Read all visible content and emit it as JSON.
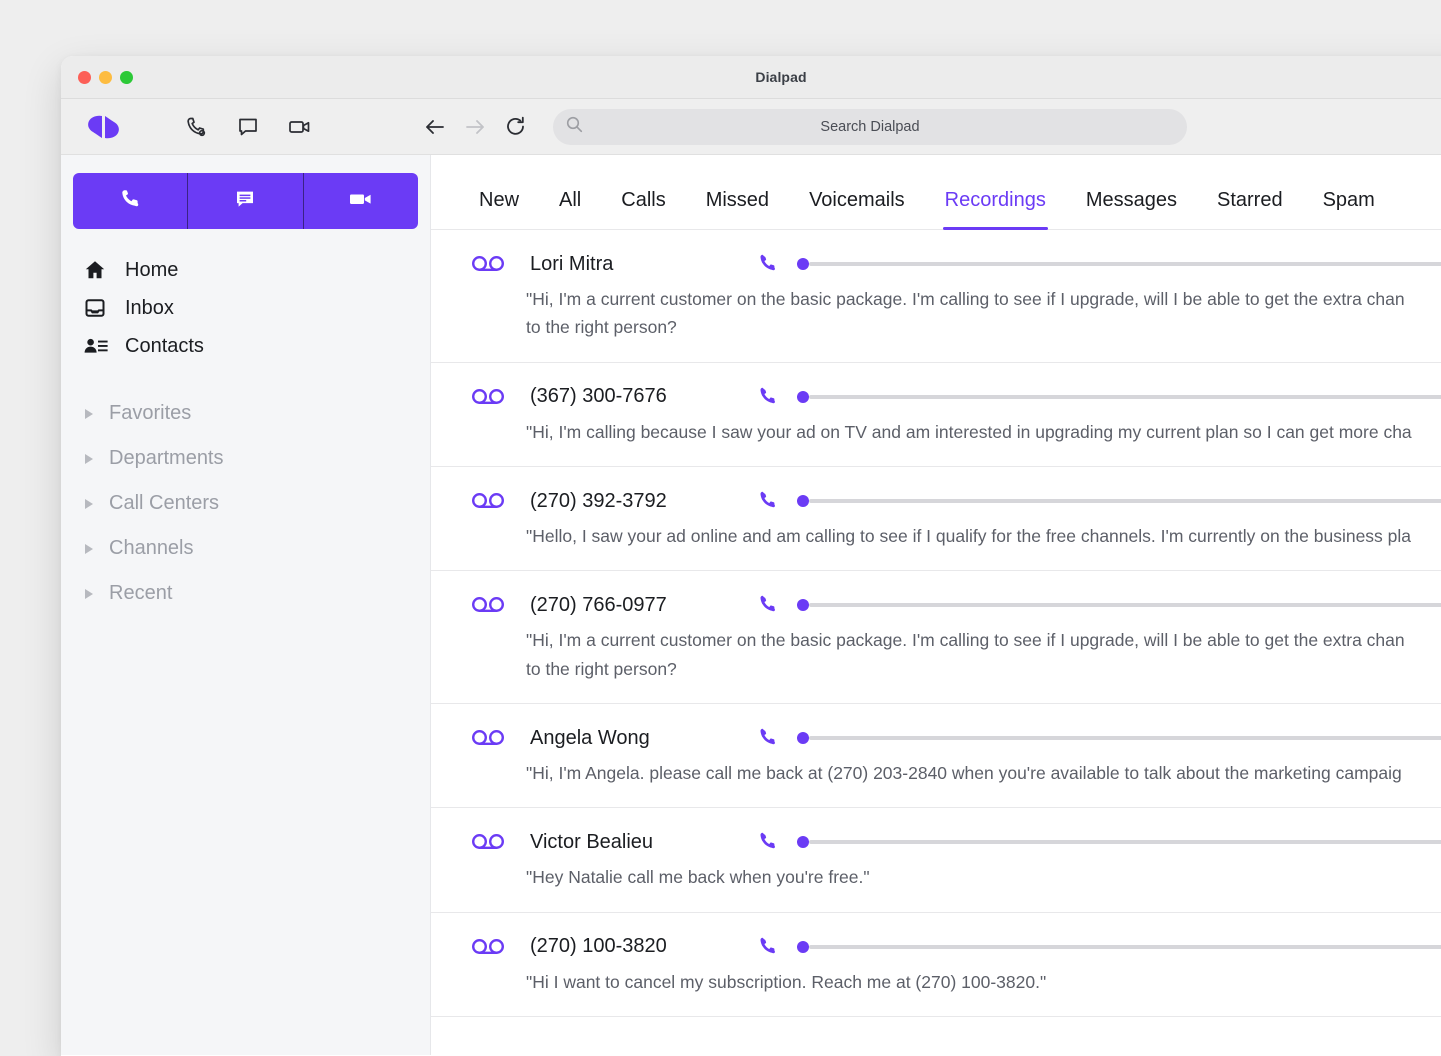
{
  "window": {
    "title": "Dialpad",
    "traffic_lights": [
      "close-red",
      "minimize-yellow",
      "maximize-green"
    ]
  },
  "colors": {
    "accent_purple": "#6b3bf5",
    "sidebar_bg": "#f5f6f8",
    "page_bg": "#eeeeee",
    "text_primary": "#1b1d21",
    "text_muted": "#9b9ea6",
    "transcript_text": "#5c5f68",
    "track_gray": "#d6d6da"
  },
  "toolbar": {
    "logo_name": "dialpad-logo",
    "icons": [
      {
        "name": "phone-icon",
        "label": "Call"
      },
      {
        "name": "message-icon",
        "label": "Message"
      },
      {
        "name": "video-icon",
        "label": "Video"
      }
    ],
    "nav": [
      {
        "name": "back-arrow-icon",
        "label": "Back",
        "enabled": true
      },
      {
        "name": "forward-arrow-icon",
        "label": "Forward",
        "enabled": false
      },
      {
        "name": "reload-icon",
        "label": "Reload",
        "enabled": true
      }
    ],
    "search": {
      "placeholder": "Search Dialpad",
      "value": "",
      "icon": "search-icon"
    }
  },
  "sidebar": {
    "actions": [
      {
        "name": "new-call-button",
        "icon": "phone-icon",
        "label": "New call"
      },
      {
        "name": "new-message-button",
        "icon": "message-icon",
        "label": "New message"
      },
      {
        "name": "new-meeting-button",
        "icon": "video-icon",
        "label": "New meeting"
      }
    ],
    "nav_items": [
      {
        "label": "Home",
        "icon": "home-icon"
      },
      {
        "label": "Inbox",
        "icon": "inbox-icon"
      },
      {
        "label": "Contacts",
        "icon": "contacts-icon"
      }
    ],
    "groups": [
      {
        "label": "Favorites",
        "icon": "chevron-right-icon",
        "expanded": false
      },
      {
        "label": "Departments",
        "icon": "chevron-right-icon",
        "expanded": false
      },
      {
        "label": "Call Centers",
        "icon": "chevron-right-icon",
        "expanded": false
      },
      {
        "label": "Channels",
        "icon": "chevron-right-icon",
        "expanded": false
      },
      {
        "label": "Recent",
        "icon": "chevron-right-icon",
        "expanded": false
      }
    ]
  },
  "main": {
    "tabs": [
      {
        "label": "New",
        "active": false
      },
      {
        "label": "All",
        "active": false
      },
      {
        "label": "Calls",
        "active": false
      },
      {
        "label": "Missed",
        "active": false
      },
      {
        "label": "Voicemails",
        "active": false
      },
      {
        "label": "Recordings",
        "active": true
      },
      {
        "label": "Messages",
        "active": false
      },
      {
        "label": "Starred",
        "active": false
      },
      {
        "label": "Spam",
        "active": false
      }
    ],
    "rows": [
      {
        "title": "Lori Mitra",
        "icon": "voicemail-icon",
        "call_icon": "phone-icon",
        "transcript": "\"Hi, I'm a current customer on the basic package. I'm calling to see if I upgrade, will I be able to get the extra chan\nto the right person?"
      },
      {
        "title": "(367) 300-7676",
        "icon": "voicemail-icon",
        "call_icon": "phone-icon",
        "transcript": "\"Hi, I'm calling because I saw your ad on TV and am interested in upgrading my current plan so I can get more cha"
      },
      {
        "title": "(270) 392-3792",
        "icon": "voicemail-icon",
        "call_icon": "phone-icon",
        "transcript": "\"Hello, I saw your ad online and am calling to see if I qualify for the free channels. I'm currently on the business pla"
      },
      {
        "title": "(270) 766-0977",
        "icon": "voicemail-icon",
        "call_icon": "phone-icon",
        "transcript": "\"Hi, I'm a current customer on the basic package. I'm calling to see if I upgrade, will I be able to get the extra chan\nto the right person?"
      },
      {
        "title": "Angela Wong",
        "icon": "voicemail-icon",
        "call_icon": "phone-icon",
        "transcript": "\"Hi, I'm Angela. please call me back at (270) 203-2840 when you're available to talk about the marketing campaig"
      },
      {
        "title": "Victor Bealieu",
        "icon": "voicemail-icon",
        "call_icon": "phone-icon",
        "transcript": "\"Hey Natalie call me back when you're free.\""
      },
      {
        "title": "(270) 100-3820",
        "icon": "voicemail-icon",
        "call_icon": "phone-icon",
        "transcript": "\"Hi I want to cancel my subscription. Reach me at (270) 100-3820.\""
      }
    ]
  }
}
